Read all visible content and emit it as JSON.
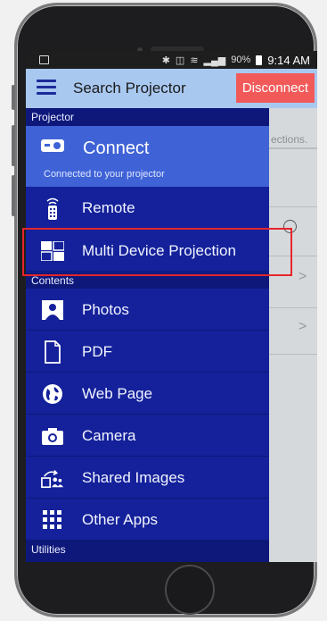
{
  "status_bar": {
    "battery": "90%",
    "time": "9:14 AM"
  },
  "app_bar": {
    "title": "Search Projector",
    "disconnect_label": "Disconnect"
  },
  "background": {
    "row_text": "ections."
  },
  "drawer": {
    "projector_section": "Projector",
    "connect": {
      "label": "Connect",
      "subtitle": "Connected to your projector"
    },
    "projector_items": [
      {
        "label": "Remote",
        "icon": "remote-icon"
      },
      {
        "label": "Multi Device Projection",
        "icon": "multi-device-icon"
      }
    ],
    "contents_section": "Contents",
    "contents_items": [
      {
        "label": "Photos",
        "icon": "photos-icon"
      },
      {
        "label": "PDF",
        "icon": "pdf-icon"
      },
      {
        "label": "Web Page",
        "icon": "web-page-icon"
      },
      {
        "label": "Camera",
        "icon": "camera-icon"
      },
      {
        "label": "Shared Images",
        "icon": "shared-images-icon"
      },
      {
        "label": "Other Apps",
        "icon": "other-apps-icon"
      }
    ],
    "utilities_section": "Utilities"
  },
  "colors": {
    "drawer_bg": "#14219a",
    "connect_bg": "#3f63d6",
    "appbar_bg": "#a9c8f0",
    "disconnect_bg": "#f25a5a",
    "highlight_border": "#e6262b"
  }
}
